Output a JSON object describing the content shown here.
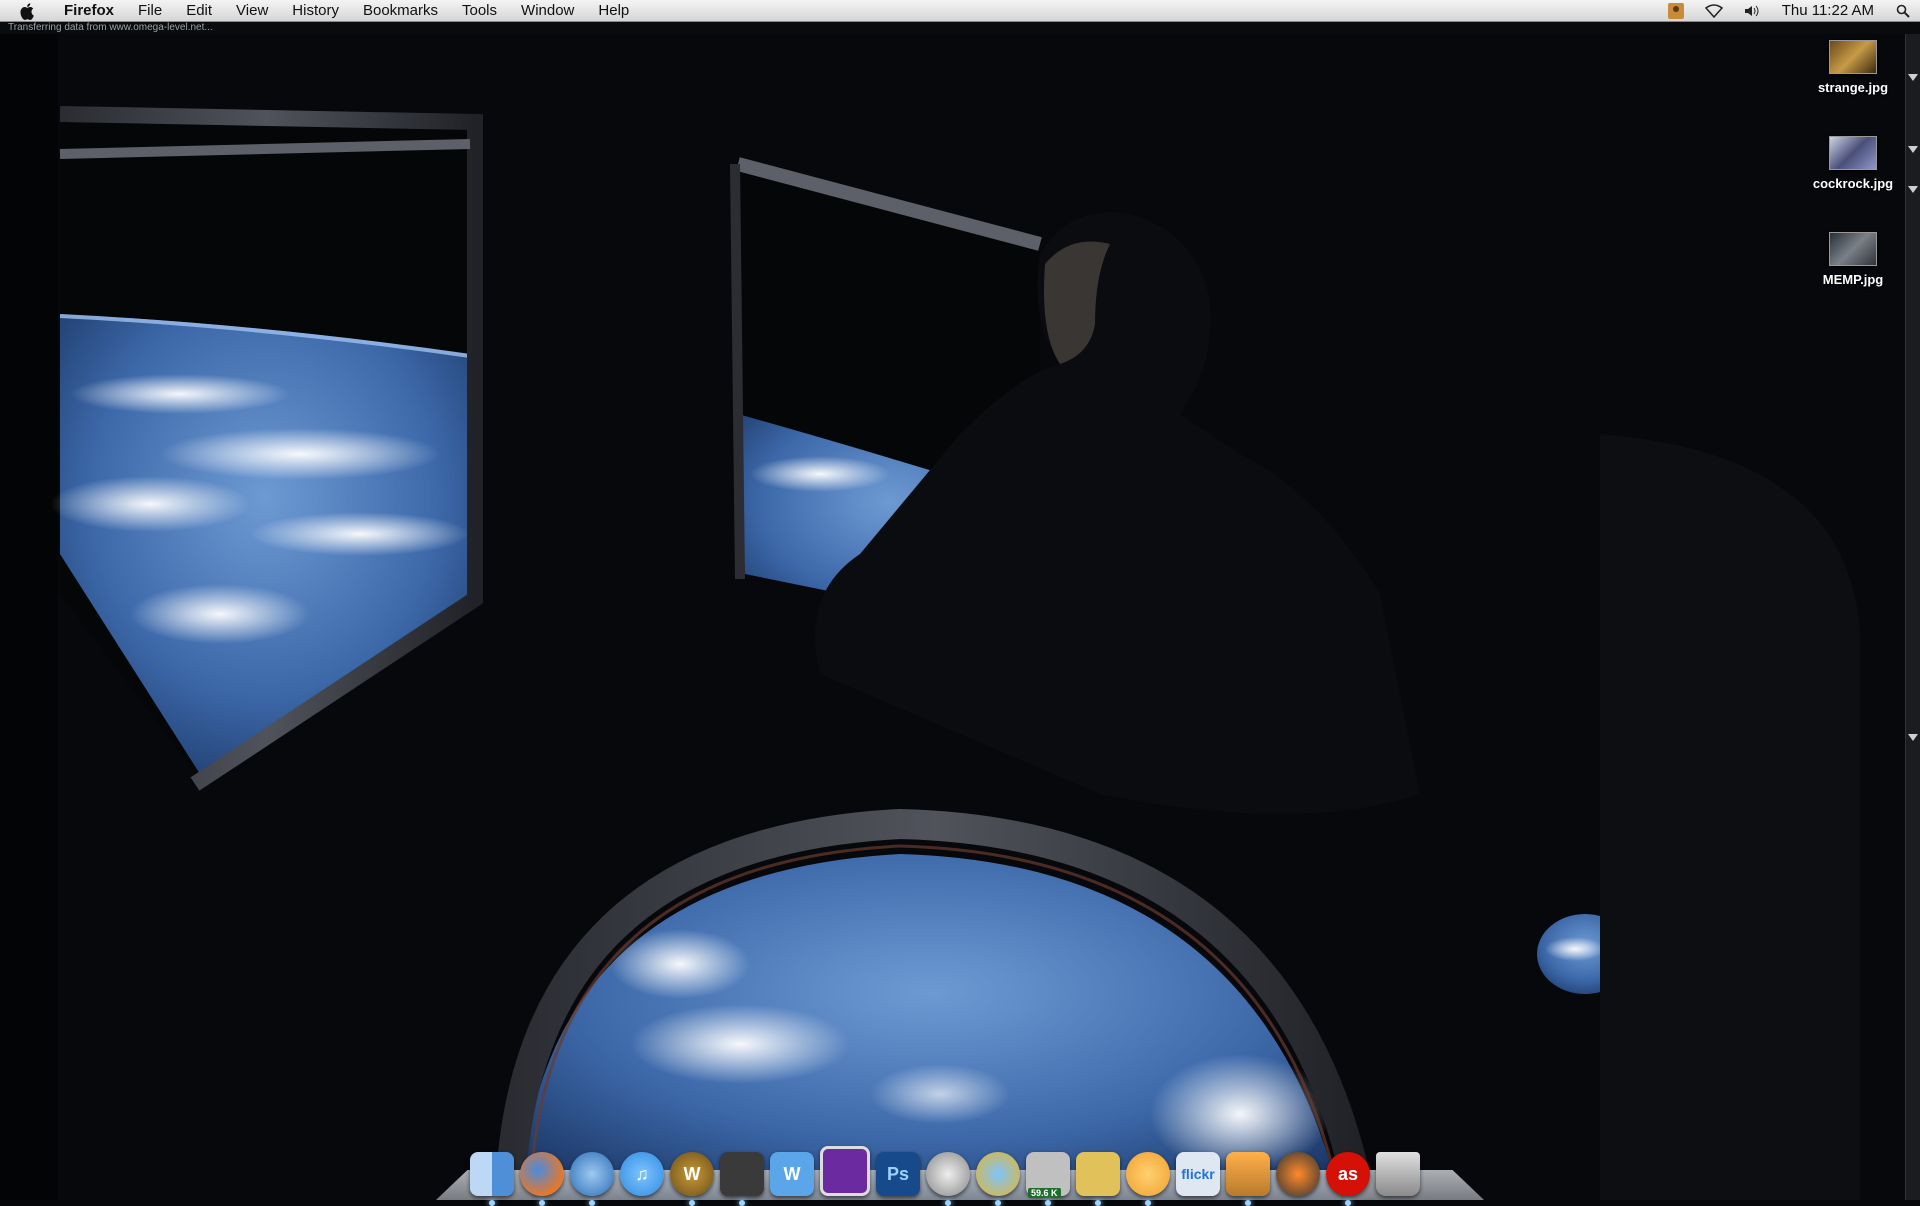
{
  "menubar": {
    "app_name": "Firefox",
    "items": [
      "File",
      "Edit",
      "View",
      "History",
      "Bookmarks",
      "Tools",
      "Window",
      "Help"
    ],
    "clock": "Thu 11:22 AM"
  },
  "status": {
    "text": "Transferring data from www.omega-level.net..."
  },
  "desktop": {
    "icons": [
      {
        "label": "strange.jpg"
      },
      {
        "label": "cockrock.jpg"
      },
      {
        "label": "MEMP.jpg"
      }
    ]
  },
  "dock": {
    "items": [
      {
        "name": "finder",
        "color": "#4f8fd8"
      },
      {
        "name": "firefox",
        "color": "#e5782a"
      },
      {
        "name": "thunderbird",
        "color": "#2a6fb8"
      },
      {
        "name": "itunes",
        "color": "#2e8be0",
        "glyph": "♫"
      },
      {
        "name": "world-of-warcraft",
        "color": "#6b4d16",
        "glyph": "W"
      },
      {
        "name": "adium",
        "color": "#3a3a3a"
      },
      {
        "name": "word-processor",
        "color": "#5aa6e8",
        "glyph": "W"
      },
      {
        "name": "purple-app",
        "color": "#6b2aa0"
      },
      {
        "name": "photoshop",
        "color": "#164a8a",
        "glyph": "Ps"
      },
      {
        "name": "chat",
        "color": "#c8c8c8"
      },
      {
        "name": "network",
        "color": "#e5b52a"
      },
      {
        "name": "download",
        "color": "#c0c0c0",
        "badge": "59.6 K"
      },
      {
        "name": "transmit",
        "color": "#e0c15a"
      },
      {
        "name": "growl",
        "color": "#f0a030"
      },
      {
        "name": "flickr-uploader",
        "color": "#dfe8f2",
        "glyph": "flickr"
      },
      {
        "name": "iphoto",
        "color": "#b97a2d"
      },
      {
        "name": "burn",
        "color": "#333333"
      },
      {
        "name": "lastfm",
        "color": "#d51007",
        "glyph": "as"
      },
      {
        "name": "trash",
        "color": "#a7a7a7"
      }
    ]
  }
}
